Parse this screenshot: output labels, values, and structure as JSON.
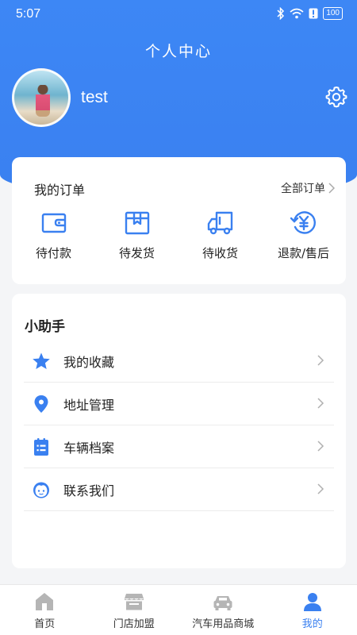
{
  "status_bar": {
    "time": "5:07",
    "battery": "100"
  },
  "header": {
    "title": "个人中心",
    "username": "test"
  },
  "orders": {
    "title": "我的订单",
    "all_label": "全部订单",
    "items": [
      {
        "label": "待付款",
        "icon": "wallet-icon"
      },
      {
        "label": "待发货",
        "icon": "package-icon"
      },
      {
        "label": "待收货",
        "icon": "truck-icon"
      },
      {
        "label": "退款/售后",
        "icon": "refund-icon"
      }
    ]
  },
  "assistant": {
    "title": "小助手",
    "items": [
      {
        "label": "我的收藏",
        "icon": "star-icon"
      },
      {
        "label": "地址管理",
        "icon": "location-icon"
      },
      {
        "label": "车辆档案",
        "icon": "clipboard-icon"
      },
      {
        "label": "联系我们",
        "icon": "customer-service-icon"
      }
    ]
  },
  "tabbar": {
    "items": [
      {
        "label": "首页",
        "icon": "home-icon"
      },
      {
        "label": "门店加盟",
        "icon": "store-icon"
      },
      {
        "label": "汽车用品商城",
        "icon": "car-icon"
      },
      {
        "label": "我的",
        "icon": "user-icon"
      }
    ],
    "active_index": 3
  },
  "colors": {
    "primary": "#3a80f0",
    "inactive_icon": "#b5b5b5"
  }
}
